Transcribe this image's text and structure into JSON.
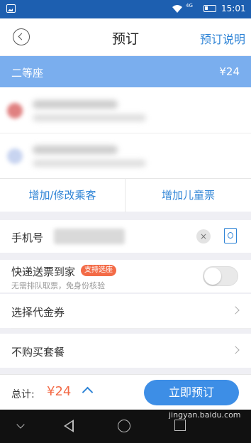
{
  "status_bar": {
    "time": "15:01",
    "network_label": "4G"
  },
  "navbar": {
    "title": "预订",
    "right_link": "预订说明"
  },
  "seat": {
    "name": "二等座",
    "price": "¥24"
  },
  "passenger_actions": {
    "add_edit": "增加/修改乘客",
    "add_child": "增加儿童票"
  },
  "phone": {
    "label": "手机号",
    "clear_icon": "×"
  },
  "delivery": {
    "title": "快递送票到家",
    "tag": "支持选座",
    "subtitle": "无需排队取票，免身份核验"
  },
  "voucher": {
    "label": "选择代金券"
  },
  "package": {
    "label": "不购买套餐"
  },
  "bottom": {
    "total_label": "总计:",
    "total_value": "¥24",
    "book_button": "立即预订"
  },
  "watermark": "jingyan.baidu.com",
  "colors": {
    "status_bar": "#1d5fb0",
    "seat_bar": "#7aaeee",
    "accent_blue": "#2f84d6",
    "accent_orange": "#f36b47"
  }
}
